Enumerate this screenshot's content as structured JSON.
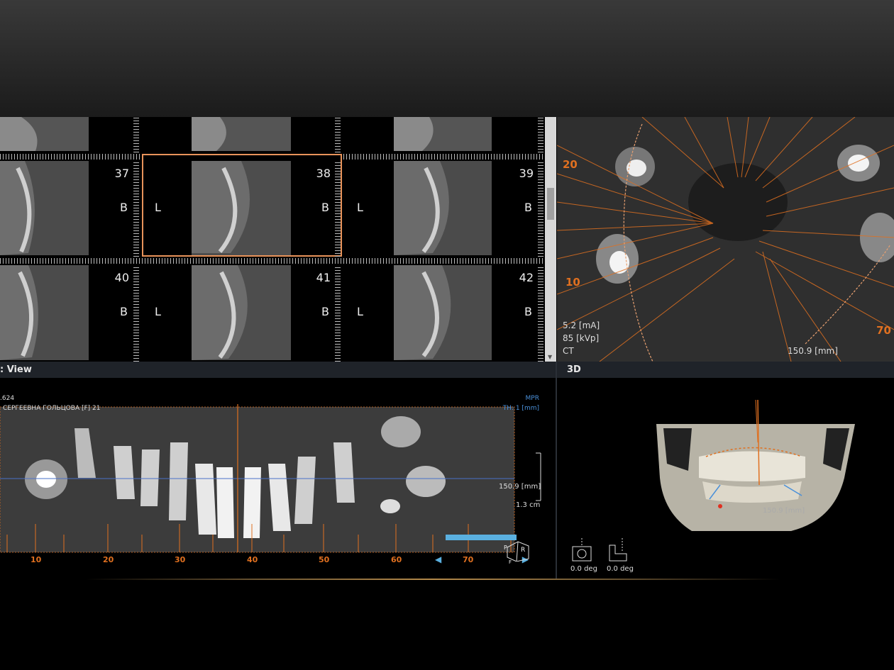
{
  "cross_sections": {
    "tiles": [
      {
        "num": "37",
        "b": "B",
        "l": ""
      },
      {
        "num": "38",
        "b": "B",
        "l": "L"
      },
      {
        "num": "39",
        "b": "B",
        "l": "L"
      },
      {
        "num": "40",
        "b": "B",
        "l": ""
      },
      {
        "num": "41",
        "b": "B",
        "l": "L"
      },
      {
        "num": "42",
        "b": "B",
        "l": "L"
      }
    ],
    "selected_index": 1
  },
  "axial": {
    "labels": {
      "l20": "20",
      "l10": "10",
      "l70": "70"
    },
    "ma": "5.2 [mA]",
    "kvp": "85 [kVp]",
    "modality": "CT",
    "length": "150.9 [mm]"
  },
  "pano": {
    "title": ": View",
    "id_text": ".624",
    "patient_text": "СЕРГЕЕВНА ГОЛЬЦОВА [F] 21",
    "mpr": "MPR",
    "th": "TH: 1 [mm]",
    "length": "150.9 [mm]",
    "scale": "1.3 cm",
    "ticks": [
      "10",
      "20",
      "30",
      "40",
      "50",
      "60",
      "70"
    ],
    "orient_r": "R",
    "orient_p": "P",
    "orient_f": "F"
  },
  "view3d": {
    "title": "3D",
    "length": "150.9 [mm]",
    "tilt1": "0.0 deg",
    "tilt2": "0.0 deg"
  },
  "colors": {
    "accent": "#e07020",
    "selection": "#e8935a",
    "mpr": "#4a90d9",
    "titlebar": "#1f2329"
  }
}
